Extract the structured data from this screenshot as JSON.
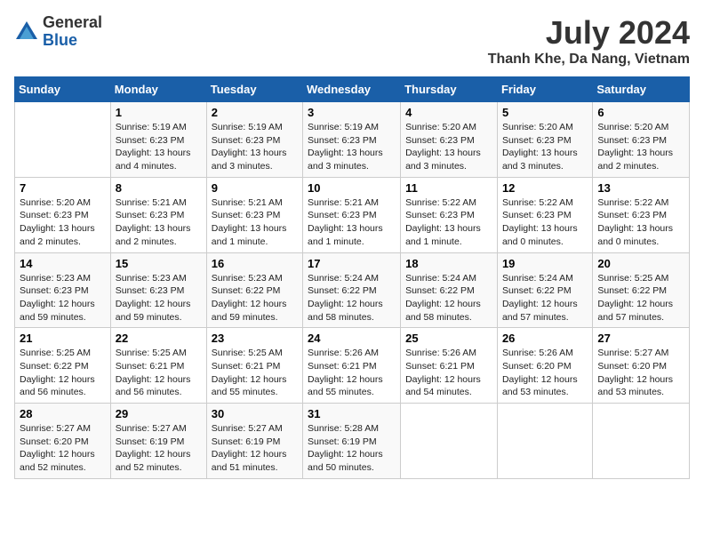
{
  "header": {
    "logo_general": "General",
    "logo_blue": "Blue",
    "month_year": "July 2024",
    "location": "Thanh Khe, Da Nang, Vietnam"
  },
  "columns": [
    "Sunday",
    "Monday",
    "Tuesday",
    "Wednesday",
    "Thursday",
    "Friday",
    "Saturday"
  ],
  "weeks": [
    [
      {
        "day": "",
        "info": ""
      },
      {
        "day": "1",
        "info": "Sunrise: 5:19 AM\nSunset: 6:23 PM\nDaylight: 13 hours\nand 4 minutes."
      },
      {
        "day": "2",
        "info": "Sunrise: 5:19 AM\nSunset: 6:23 PM\nDaylight: 13 hours\nand 3 minutes."
      },
      {
        "day": "3",
        "info": "Sunrise: 5:19 AM\nSunset: 6:23 PM\nDaylight: 13 hours\nand 3 minutes."
      },
      {
        "day": "4",
        "info": "Sunrise: 5:20 AM\nSunset: 6:23 PM\nDaylight: 13 hours\nand 3 minutes."
      },
      {
        "day": "5",
        "info": "Sunrise: 5:20 AM\nSunset: 6:23 PM\nDaylight: 13 hours\nand 3 minutes."
      },
      {
        "day": "6",
        "info": "Sunrise: 5:20 AM\nSunset: 6:23 PM\nDaylight: 13 hours\nand 2 minutes."
      }
    ],
    [
      {
        "day": "7",
        "info": "Sunrise: 5:20 AM\nSunset: 6:23 PM\nDaylight: 13 hours\nand 2 minutes."
      },
      {
        "day": "8",
        "info": "Sunrise: 5:21 AM\nSunset: 6:23 PM\nDaylight: 13 hours\nand 2 minutes."
      },
      {
        "day": "9",
        "info": "Sunrise: 5:21 AM\nSunset: 6:23 PM\nDaylight: 13 hours\nand 1 minute."
      },
      {
        "day": "10",
        "info": "Sunrise: 5:21 AM\nSunset: 6:23 PM\nDaylight: 13 hours\nand 1 minute."
      },
      {
        "day": "11",
        "info": "Sunrise: 5:22 AM\nSunset: 6:23 PM\nDaylight: 13 hours\nand 1 minute."
      },
      {
        "day": "12",
        "info": "Sunrise: 5:22 AM\nSunset: 6:23 PM\nDaylight: 13 hours\nand 0 minutes."
      },
      {
        "day": "13",
        "info": "Sunrise: 5:22 AM\nSunset: 6:23 PM\nDaylight: 13 hours\nand 0 minutes."
      }
    ],
    [
      {
        "day": "14",
        "info": "Sunrise: 5:23 AM\nSunset: 6:23 PM\nDaylight: 12 hours\nand 59 minutes."
      },
      {
        "day": "15",
        "info": "Sunrise: 5:23 AM\nSunset: 6:23 PM\nDaylight: 12 hours\nand 59 minutes."
      },
      {
        "day": "16",
        "info": "Sunrise: 5:23 AM\nSunset: 6:22 PM\nDaylight: 12 hours\nand 59 minutes."
      },
      {
        "day": "17",
        "info": "Sunrise: 5:24 AM\nSunset: 6:22 PM\nDaylight: 12 hours\nand 58 minutes."
      },
      {
        "day": "18",
        "info": "Sunrise: 5:24 AM\nSunset: 6:22 PM\nDaylight: 12 hours\nand 58 minutes."
      },
      {
        "day": "19",
        "info": "Sunrise: 5:24 AM\nSunset: 6:22 PM\nDaylight: 12 hours\nand 57 minutes."
      },
      {
        "day": "20",
        "info": "Sunrise: 5:25 AM\nSunset: 6:22 PM\nDaylight: 12 hours\nand 57 minutes."
      }
    ],
    [
      {
        "day": "21",
        "info": "Sunrise: 5:25 AM\nSunset: 6:22 PM\nDaylight: 12 hours\nand 56 minutes."
      },
      {
        "day": "22",
        "info": "Sunrise: 5:25 AM\nSunset: 6:21 PM\nDaylight: 12 hours\nand 56 minutes."
      },
      {
        "day": "23",
        "info": "Sunrise: 5:25 AM\nSunset: 6:21 PM\nDaylight: 12 hours\nand 55 minutes."
      },
      {
        "day": "24",
        "info": "Sunrise: 5:26 AM\nSunset: 6:21 PM\nDaylight: 12 hours\nand 55 minutes."
      },
      {
        "day": "25",
        "info": "Sunrise: 5:26 AM\nSunset: 6:21 PM\nDaylight: 12 hours\nand 54 minutes."
      },
      {
        "day": "26",
        "info": "Sunrise: 5:26 AM\nSunset: 6:20 PM\nDaylight: 12 hours\nand 53 minutes."
      },
      {
        "day": "27",
        "info": "Sunrise: 5:27 AM\nSunset: 6:20 PM\nDaylight: 12 hours\nand 53 minutes."
      }
    ],
    [
      {
        "day": "28",
        "info": "Sunrise: 5:27 AM\nSunset: 6:20 PM\nDaylight: 12 hours\nand 52 minutes."
      },
      {
        "day": "29",
        "info": "Sunrise: 5:27 AM\nSunset: 6:19 PM\nDaylight: 12 hours\nand 52 minutes."
      },
      {
        "day": "30",
        "info": "Sunrise: 5:27 AM\nSunset: 6:19 PM\nDaylight: 12 hours\nand 51 minutes."
      },
      {
        "day": "31",
        "info": "Sunrise: 5:28 AM\nSunset: 6:19 PM\nDaylight: 12 hours\nand 50 minutes."
      },
      {
        "day": "",
        "info": ""
      },
      {
        "day": "",
        "info": ""
      },
      {
        "day": "",
        "info": ""
      }
    ]
  ]
}
